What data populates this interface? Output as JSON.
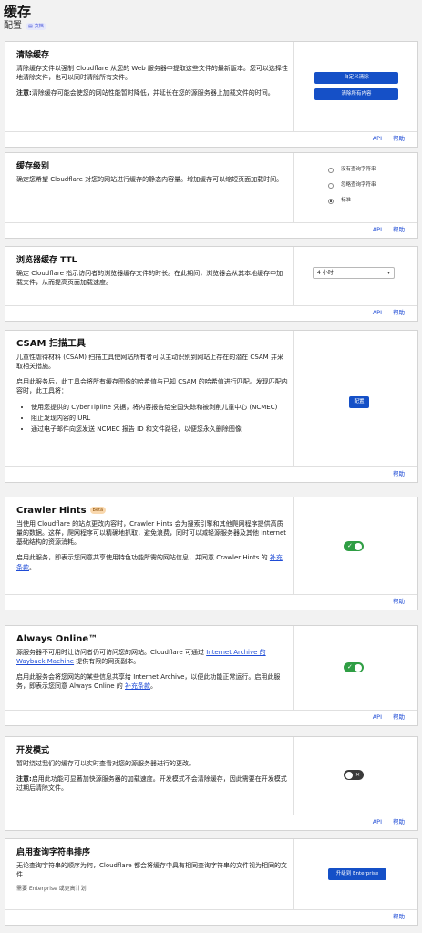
{
  "header": {
    "title": "缓存",
    "subtitle": "配置",
    "doc_label": "文档"
  },
  "footer_api": "API",
  "footer_help": "帮助",
  "purge": {
    "title": "清除缓存",
    "desc": "清除缓存文件以强制 Cloudflare 从您的 Web 服务器中提取这些文件的最新版本。您可以选择性地清除文件，也可以同时清除所有文件。",
    "note_label": "注意:",
    "note": "清除缓存可能会使您的网站性能暂时降低，并延长在您的源服务器上加载文件的时间。",
    "custom_button": "自定义清除",
    "all_button": "清除所有内容"
  },
  "cache_level": {
    "title": "缓存级别",
    "desc": "确定您希望 Cloudflare 对您的网站进行缓存的静态内容量。增加缓存可以缩短页面加载时间。",
    "options": [
      "没有查询字符串",
      "忽略查询字符串",
      "标准"
    ]
  },
  "browser_ttl": {
    "title": "浏览器缓存 TTL",
    "desc": "确定 Cloudflare 指示访问者的浏览器缓存文件的时长。在此期间，浏览器会从其本地缓存中加载文件，从而提高页面加载速度。",
    "selected": "4 小时"
  },
  "csam": {
    "title": "CSAM 扫描工具",
    "desc1": "儿童性虐待材料 (CSAM) 扫描工具使网站所有者可以主动识别到网站上存在的潜在 CSAM 并采取相关措施。",
    "desc2": "启用此服务后，此工具会将所有缓存图像的哈希值与已知 CSAM 的哈希值进行匹配。发现匹配内容时，此工具将：",
    "bullets": [
      "使用您提供的 CyberTipline 凭据，将内容报告给全国失踪和被剥削儿童中心 (NCMEC)",
      "阻止发现内容的 URL",
      "通过电子邮件向您发送 NCMEC 报告 ID 和文件路径，以便您永久删除图像"
    ],
    "config_button": "配置"
  },
  "crawler": {
    "title": "Crawler Hints",
    "beta": "Beta",
    "desc1": "当使用 Cloudflare 的站点更改内容时，Crawler Hints 会为搜索引擎和其他爬网程序提供高质量的数据。这样，爬网程序可以精确地抓取，避免浪费，同时可以减轻源服务器及其他 Internet 基础结构的资源消耗。",
    "desc2_pre": "启用此服务，即表示您同意共享使用特色功能所需的网站信息，并同意 Crawler Hints 的 ",
    "desc2_link": "补充条款",
    "desc2_post": "。"
  },
  "always_online": {
    "title": "Always Online™",
    "desc1_pre": "源服务器不可用时让访问者仍可访问您的网站。Cloudflare 可通过 ",
    "desc1_link": "Internet Archive 的 Wayback Machine",
    "desc1_post": " 提供有限的网页副本。",
    "desc2_pre": "启用此服务会将您网站的某些信息共享给 Internet Archive，以便此功能正常运行。启用此服务，即表示您同意 Always Online 的 ",
    "desc2_link": "补充条款",
    "desc2_post": "。"
  },
  "dev_mode": {
    "title": "开发模式",
    "desc": "暂时绕过我们的缓存可以实时查看对您的源服务器进行的更改。",
    "note_label": "注意:",
    "note": "启用此功能可显著加快源服务器的加载速度。开发模式不会清除缓存，因此需要在开发模式过期后清除文件。"
  },
  "query_sort": {
    "title": "启用查询字符串排序",
    "desc": "无论查询字符串的顺序为何，Cloudflare 都会将缓存中具有相同查询字符串的文件视为相同的文件",
    "req": "需要 Enterprise 或更高计划",
    "upgrade_button": "升级到 Enterprise"
  }
}
